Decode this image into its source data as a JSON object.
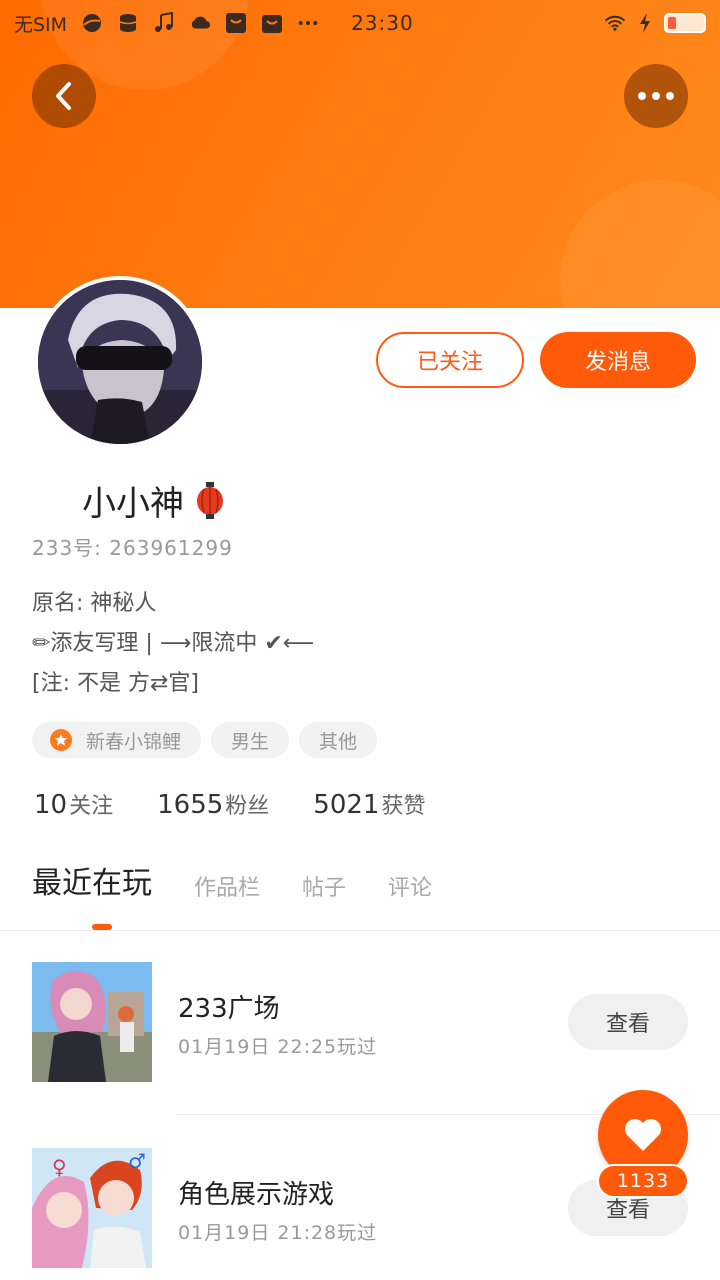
{
  "status_bar": {
    "carrier": "无SIM",
    "time": "23:30",
    "icons": [
      "browser-icon",
      "database-icon",
      "music-icon",
      "cloud-icon",
      "shop-icon",
      "bag-icon",
      "more-dots-icon",
      "wifi-icon",
      "charging-icon",
      "battery-icon"
    ]
  },
  "header": {
    "back_icon": "back-arrow-icon",
    "more_icon": "more-dots-icon",
    "gradient_colors": [
      "#ff6a00",
      "#ff8a1c"
    ]
  },
  "actions": {
    "follow_label": "已关注",
    "message_label": "发消息",
    "accent": "#ff5a0a"
  },
  "profile": {
    "name": "小小神",
    "name_emoji": "lantern-icon",
    "uid": "233号: 263961299",
    "bio": [
      "原名: 神秘人",
      "✏添友写理 | ⟶限流中 ✔⟵",
      "[注: 不是 方⇄官]"
    ],
    "tags": [
      "新春小锦鲤",
      "男生",
      "其他"
    ]
  },
  "stats": {
    "following_num": "10",
    "following_label": "关注",
    "fans_num": "1655",
    "fans_label": "粉丝",
    "likes_num": "5021",
    "likes_label": "获赞"
  },
  "tabs": [
    "最近在玩",
    "作品栏",
    "帖子",
    "评论"
  ],
  "games": [
    {
      "title": "233广场",
      "meta": "01月19日 22:25玩过",
      "action": "查看"
    },
    {
      "title": "角色展示游戏",
      "meta": "01月19日 21:28玩过",
      "action": "查看"
    }
  ],
  "like": {
    "count": "1133"
  }
}
